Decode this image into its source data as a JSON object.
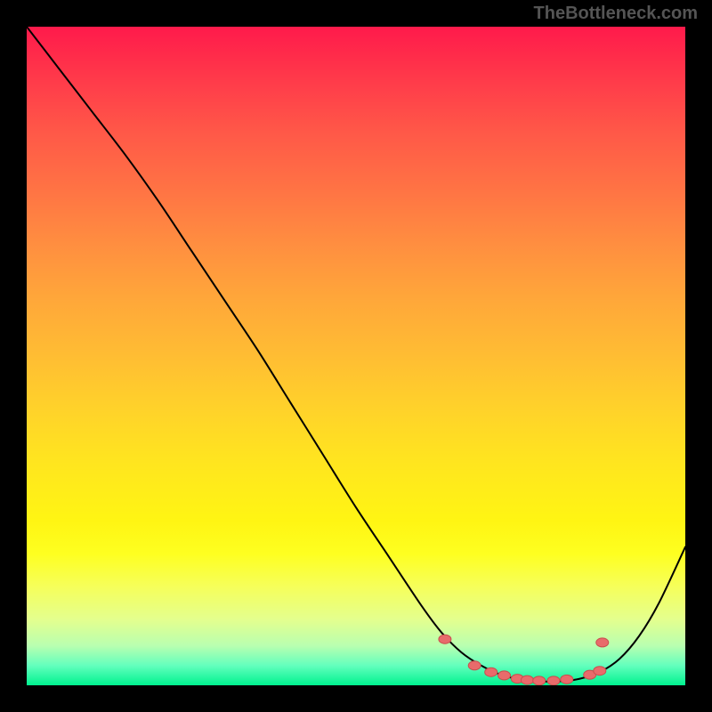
{
  "attribution": "TheBottleneck.com",
  "colors": {
    "marker_fill": "#e86b6b",
    "marker_stroke": "#c94e4e",
    "curve_stroke": "#000000"
  },
  "chart_data": {
    "type": "line",
    "title": "",
    "xlabel": "",
    "ylabel": "",
    "xlim": [
      0,
      100
    ],
    "ylim": [
      0,
      100
    ],
    "grid": false,
    "legend": false,
    "series": [
      {
        "name": "bottleneck_curve",
        "x": [
          0,
          5,
          10,
          15,
          20,
          25,
          30,
          35,
          40,
          45,
          50,
          55,
          60,
          63,
          66,
          69,
          72,
          75,
          78,
          81,
          84,
          87,
          90,
          93,
          96,
          100
        ],
        "y": [
          100,
          93.5,
          87,
          80.5,
          73.5,
          66,
          58.5,
          51,
          43,
          35,
          27,
          19.5,
          12,
          8,
          5,
          3,
          1.6,
          0.9,
          0.6,
          0.6,
          1.0,
          2.0,
          4.0,
          7.5,
          12.5,
          21
        ]
      }
    ],
    "markers": [
      {
        "x": 63.5,
        "y": 7.0
      },
      {
        "x": 68.0,
        "y": 3.0
      },
      {
        "x": 70.5,
        "y": 2.0
      },
      {
        "x": 72.5,
        "y": 1.5
      },
      {
        "x": 74.5,
        "y": 1.0
      },
      {
        "x": 76.0,
        "y": 0.8
      },
      {
        "x": 77.8,
        "y": 0.7
      },
      {
        "x": 80.0,
        "y": 0.7
      },
      {
        "x": 82.0,
        "y": 0.9
      },
      {
        "x": 85.5,
        "y": 1.6
      },
      {
        "x": 87.0,
        "y": 2.2
      },
      {
        "x": 87.4,
        "y": 6.5
      }
    ]
  }
}
